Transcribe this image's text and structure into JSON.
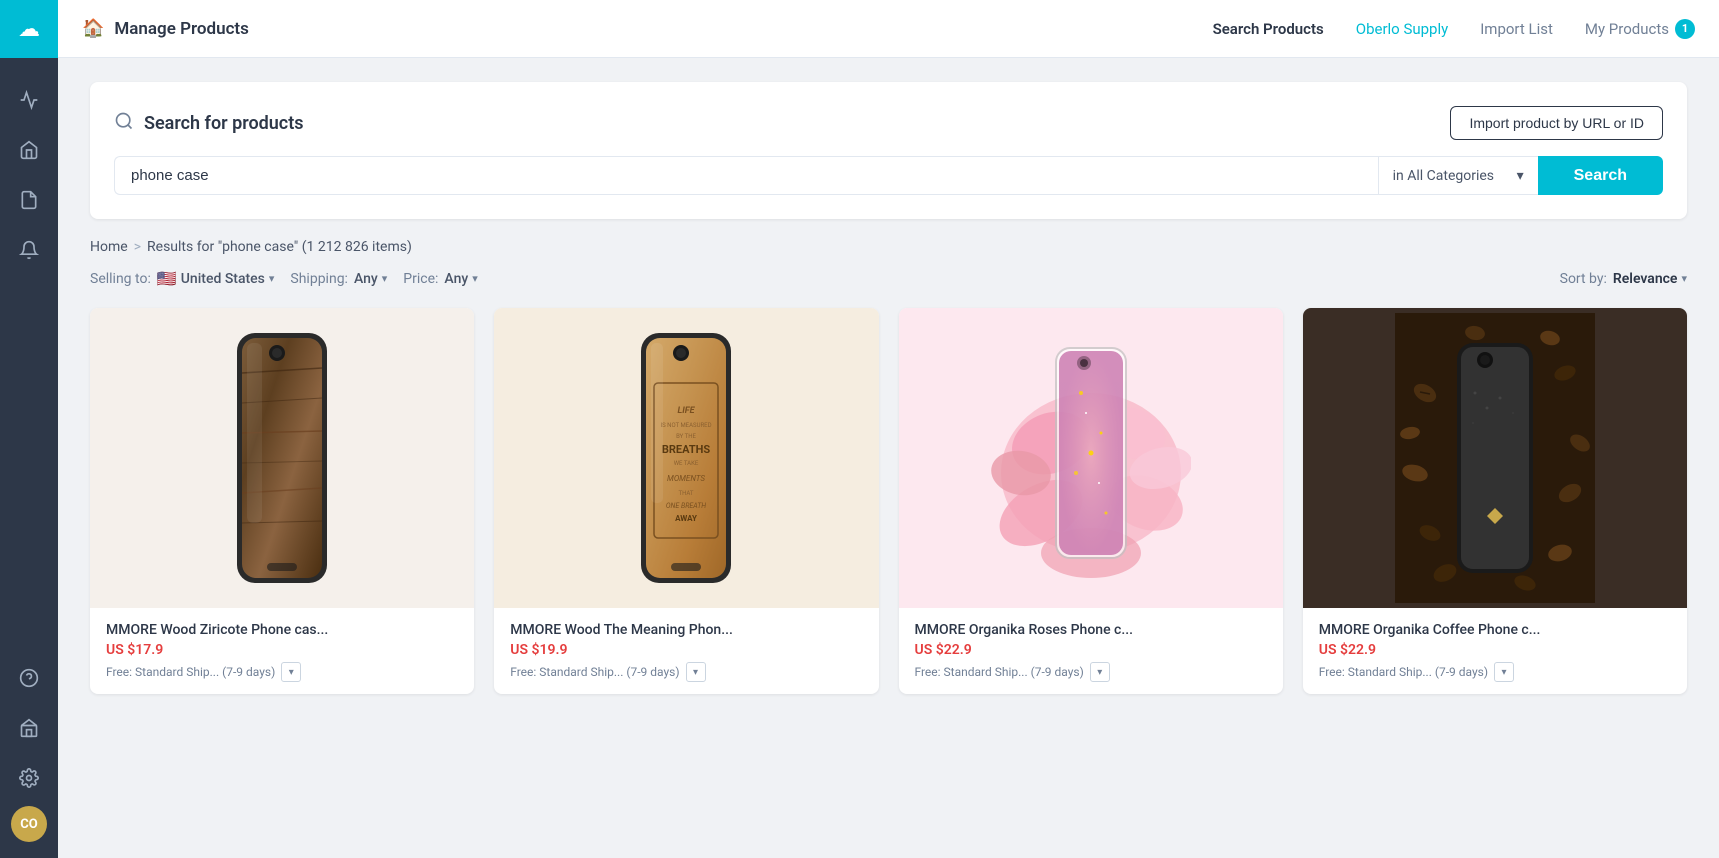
{
  "sidebar": {
    "logo_text": "☁",
    "nav_items": [
      {
        "name": "analytics",
        "icon": "📈"
      },
      {
        "name": "home",
        "icon": "🏠"
      },
      {
        "name": "products",
        "icon": "📄"
      },
      {
        "name": "notifications",
        "icon": "🔔"
      }
    ],
    "bottom_items": [
      {
        "name": "help",
        "icon": "?"
      },
      {
        "name": "store",
        "icon": "🏪"
      },
      {
        "name": "settings",
        "icon": "⚙"
      }
    ],
    "avatar_text": "CO"
  },
  "topnav": {
    "page_icon": "🏠",
    "page_title": "Manage Products",
    "links": [
      {
        "label": "Search Products",
        "active": true
      },
      {
        "label": "Oberlo Supply",
        "accent": true
      },
      {
        "label": "Import List"
      },
      {
        "label": "My Products",
        "badge": "1"
      }
    ]
  },
  "search_section": {
    "title": "Search for products",
    "import_btn_label": "Import product by URL or ID",
    "search_placeholder": "phone case",
    "category_label": "in All Categories",
    "search_btn_label": "Search"
  },
  "breadcrumb": {
    "home": "Home",
    "separator": ">",
    "current": "Results for \"phone case\" (1 212 826 items)"
  },
  "filters": {
    "selling_to_label": "Selling to:",
    "selling_to_value": "United States",
    "shipping_label": "Shipping:",
    "shipping_value": "Any",
    "price_label": "Price:",
    "price_value": "Any",
    "sort_label": "Sort by:",
    "sort_value": "Relevance"
  },
  "products": [
    {
      "name": "MMORE Wood Ziricote Phone cas...",
      "price": "US $17.9",
      "shipping": "Free: Standard Ship... (7-9 days)",
      "color": "wood_dark",
      "id": "card-1"
    },
    {
      "name": "MMORE Wood The Meaning Phon...",
      "price": "US $19.9",
      "shipping": "Free: Standard Ship... (7-9 days)",
      "color": "wood_light",
      "id": "card-2"
    },
    {
      "name": "MMORE Organika Roses Phone c...",
      "price": "US $22.9",
      "shipping": "Free: Standard Ship... (7-9 days)",
      "color": "roses_pink",
      "id": "card-3"
    },
    {
      "name": "MMORE Organika Coffee Phone c...",
      "price": "US $22.9",
      "shipping": "Free: Standard Ship... (7-9 days)",
      "color": "coffee_dark",
      "id": "card-4"
    }
  ]
}
